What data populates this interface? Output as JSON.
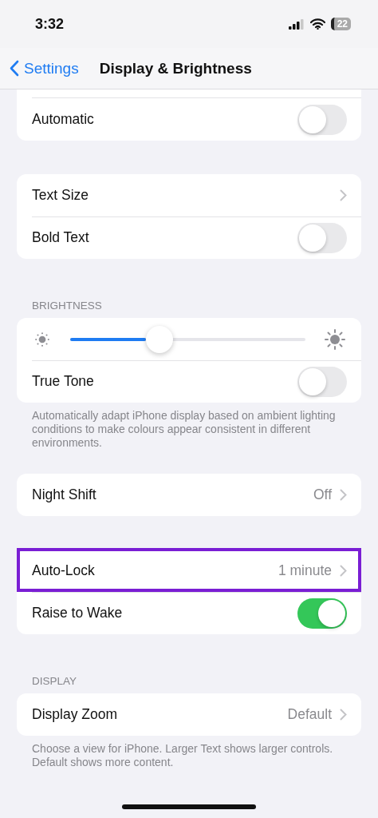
{
  "status_bar": {
    "time": "3:32",
    "battery": "22"
  },
  "nav": {
    "back": "Settings",
    "title": "Display & Brightness"
  },
  "sections": [
    {
      "cut_off": true,
      "rows": [
        {
          "kind": "toggle",
          "label": "Automatic",
          "on": false
        }
      ]
    },
    {
      "rows": [
        {
          "kind": "link",
          "label": "Text Size"
        },
        {
          "kind": "toggle",
          "label": "Bold Text",
          "on": false
        }
      ]
    },
    {
      "header": "BRIGHTNESS",
      "rows": [
        {
          "kind": "slider",
          "level": 0.38
        },
        {
          "kind": "toggle",
          "label": "True Tone",
          "on": false
        }
      ],
      "footer": "Automatically adapt iPhone display based on ambient lighting conditions to make colours appear consistent in different environments."
    },
    {
      "rows": [
        {
          "kind": "link",
          "label": "Night Shift",
          "value": "Off"
        }
      ]
    },
    {
      "rows": [
        {
          "kind": "link",
          "label": "Auto-Lock",
          "value": "1 minute",
          "highlighted": true
        },
        {
          "kind": "toggle",
          "label": "Raise to Wake",
          "on": true
        }
      ]
    },
    {
      "header": "DISPLAY",
      "rows": [
        {
          "kind": "link",
          "label": "Display Zoom",
          "value": "Default"
        }
      ],
      "footer": "Choose a view for iPhone. Larger Text shows larger controls. Default shows more content."
    }
  ]
}
